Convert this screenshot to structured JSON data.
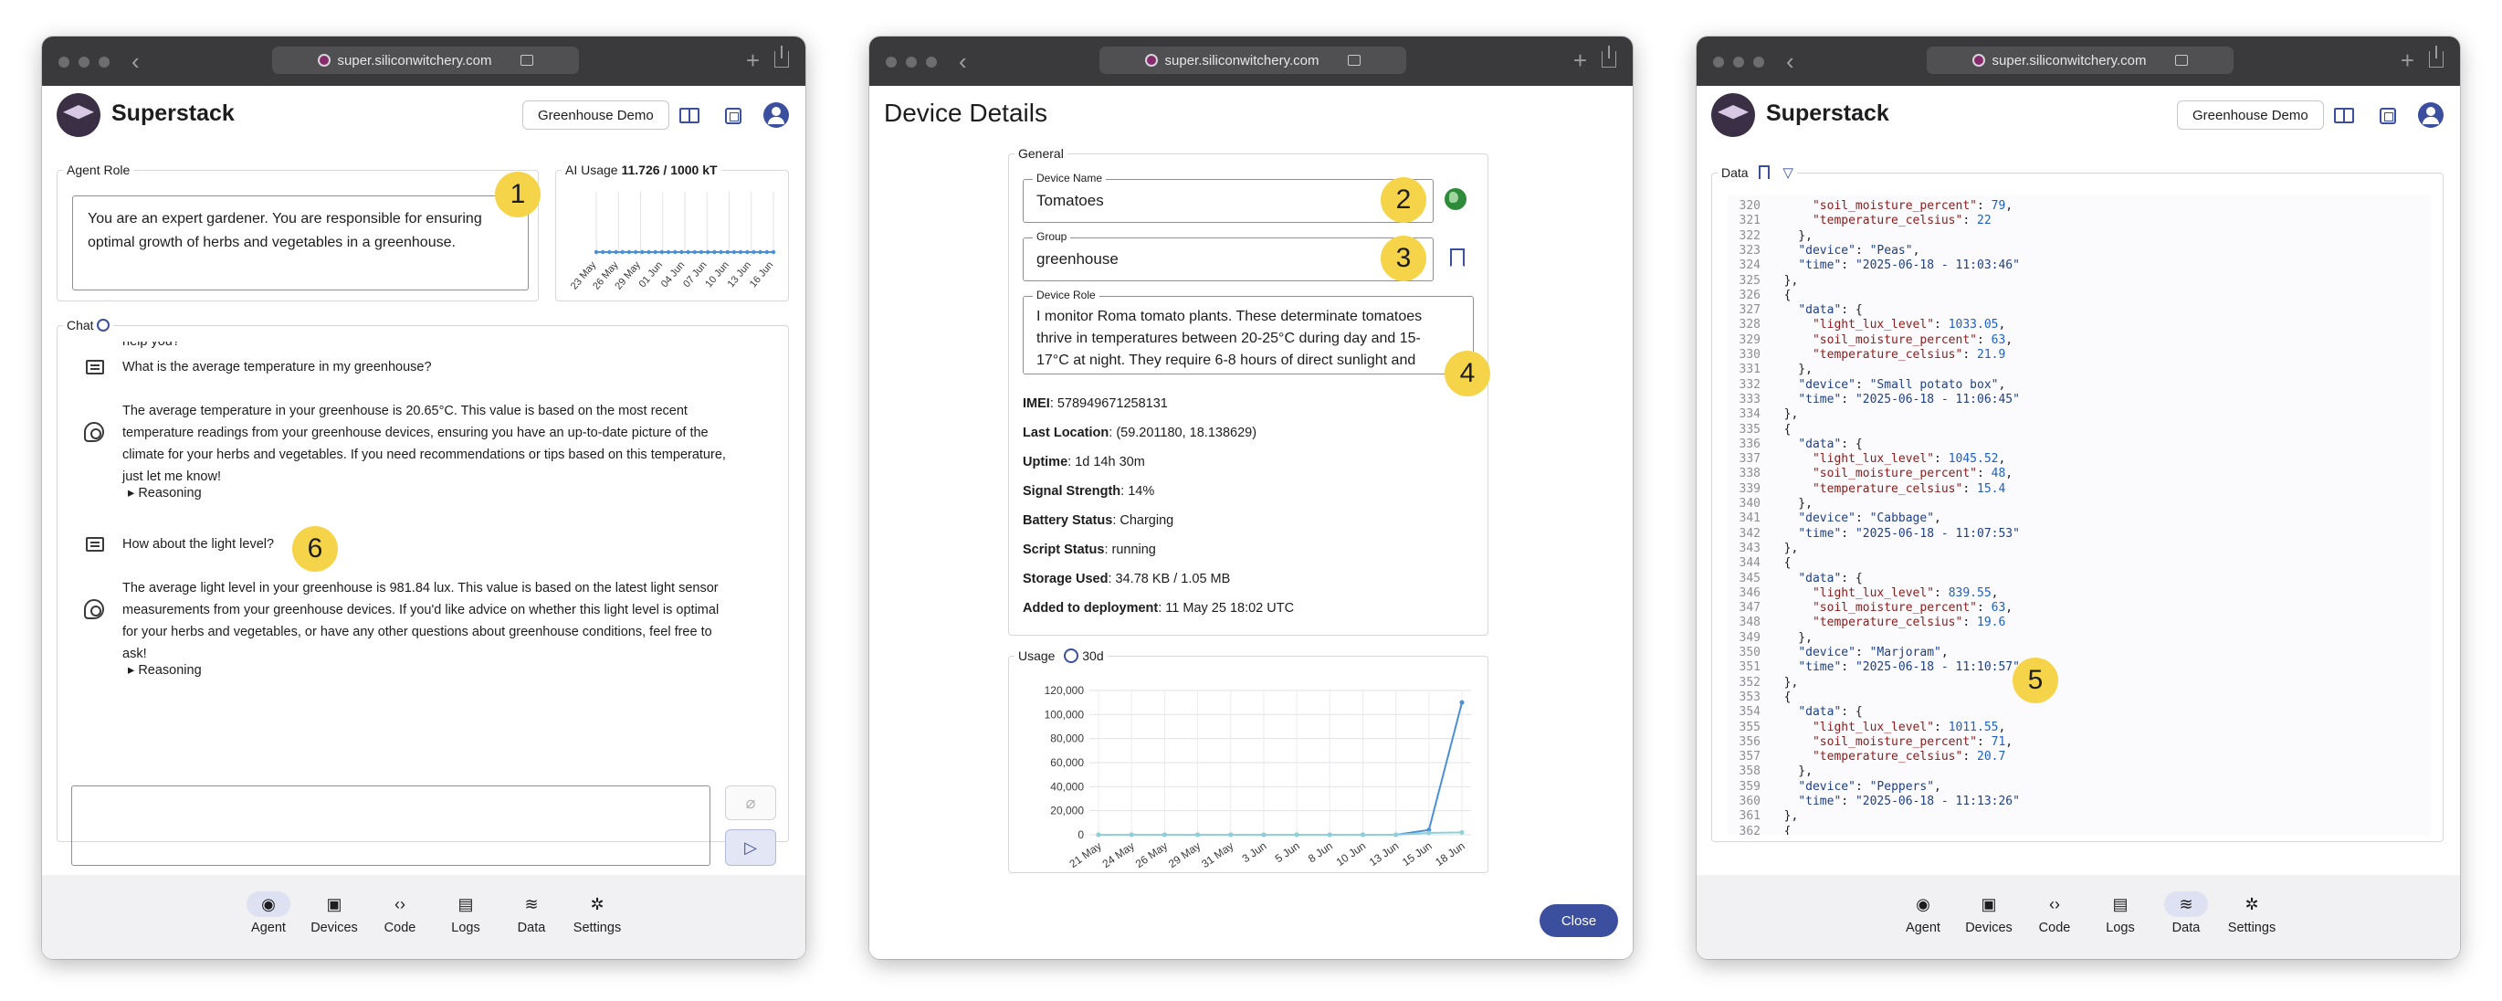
{
  "browser": {
    "url": "super.siliconwitchery.com"
  },
  "app": {
    "name": "Superstack",
    "demo_button": "Greenhouse Demo"
  },
  "nav": [
    "Agent",
    "Devices",
    "Code",
    "Logs",
    "Data",
    "Settings"
  ],
  "left": {
    "agent_role_legend": "Agent Role",
    "agent_role_text": "You are an expert gardener. You are responsible for ensuring optimal growth of herbs and vegetables in a greenhouse.",
    "usage_legend_prefix": "AI Usage ",
    "usage_value": "11.726 / 1000 kT",
    "usage_ticks": [
      "23 May",
      "26 May",
      "29 May",
      "01 Jun",
      "04 Jun",
      "07 Jun",
      "10 Jun",
      "13 Jun",
      "16 Jun"
    ],
    "chat_legend": "Chat",
    "chat": {
      "clipped_top": "help you?",
      "q1": "What is the average temperature in my greenhouse?",
      "a1": [
        "The average temperature in your greenhouse is 20.65°C. This value is based on the most recent",
        "temperature readings from your greenhouse devices, ensuring you have an up-to-date picture of the",
        "climate for your herbs and vegetables. If you need recommendations or tips based on this temperature,",
        "just let me know!"
      ],
      "reasoning1": "Reasoning",
      "q2": "How about the light level?",
      "a2": [
        "The average light level in your greenhouse is 981.84 lux. This value is based on the latest light sensor",
        "measurements from your greenhouse devices. If you'd like advice on whether this light level is optimal",
        "for your herbs and vegetables, or have any other questions about greenhouse conditions, feel free to",
        "ask!"
      ],
      "reasoning2": "Reasoning"
    },
    "badges": {
      "b1": "1",
      "b6": "6"
    },
    "active_nav": "Agent"
  },
  "middle": {
    "title": "Device Details",
    "general_legend": "General",
    "device_name_label": "Device Name",
    "device_name": "Tomatoes",
    "group_label": "Group",
    "group": "greenhouse",
    "device_role_label": "Device Role",
    "device_role_lines": [
      "I monitor Roma tomato plants. These determinate tomatoes",
      "thrive in temperatures between 20-25°C during day and 15-",
      "17°C at night. They require 6-8 hours of direct sunlight and"
    ],
    "info": [
      {
        "k": "IMEI",
        "v": ": 578949671258131"
      },
      {
        "k": "Last Location",
        "v": ": (59.201180, 18.138629)"
      },
      {
        "k": "Uptime",
        "v": ": 1d 14h 30m"
      },
      {
        "k": "Signal Strength",
        "v": ": 14%"
      },
      {
        "k": "Battery Status",
        "v": ": Charging"
      },
      {
        "k": "Script Status",
        "v": ": running"
      },
      {
        "k": "Storage Used",
        "v": ": 34.78 KB / 1.05 MB"
      },
      {
        "k": "Added to deployment",
        "v": ": 11 May 25 18:02 UTC"
      }
    ],
    "usage_legend": "Usage",
    "usage_range": "30d",
    "close_label": "Close",
    "badges": {
      "b2": "2",
      "b3": "3",
      "b4": "4"
    }
  },
  "right": {
    "data_legend": "Data",
    "badge": "5",
    "active_nav": "Data",
    "code_lines": [
      {
        "n": "320",
        "t": [
          [
            "      ",
            ""
          ],
          [
            "\"soil_moisture_percent\"",
            "s"
          ],
          [
            ": ",
            ""
          ],
          [
            "79",
            "n"
          ],
          [
            ",",
            ""
          ]
        ]
      },
      {
        "n": "321",
        "t": [
          [
            "      ",
            ""
          ],
          [
            "\"temperature_celsius\"",
            "s"
          ],
          [
            ": ",
            ""
          ],
          [
            "22",
            "n"
          ]
        ]
      },
      {
        "n": "322",
        "t": [
          [
            "    },",
            ""
          ]
        ]
      },
      {
        "n": "323",
        "t": [
          [
            "    ",
            ""
          ],
          [
            "\"device\"",
            "k"
          ],
          [
            ": ",
            ""
          ],
          [
            "\"Peas\"",
            "k"
          ],
          [
            ",",
            ""
          ]
        ]
      },
      {
        "n": "324",
        "t": [
          [
            "    ",
            ""
          ],
          [
            "\"time\"",
            "k"
          ],
          [
            ": ",
            ""
          ],
          [
            "\"2025-06-18 - 11:03:46\"",
            "k"
          ]
        ]
      },
      {
        "n": "325",
        "t": [
          [
            "  },",
            ""
          ]
        ]
      },
      {
        "n": "326",
        "t": [
          [
            "  {",
            ""
          ]
        ]
      },
      {
        "n": "327",
        "t": [
          [
            "    ",
            ""
          ],
          [
            "\"data\"",
            "k"
          ],
          [
            ": {",
            ""
          ]
        ]
      },
      {
        "n": "328",
        "t": [
          [
            "      ",
            ""
          ],
          [
            "\"light_lux_level\"",
            "s"
          ],
          [
            ": ",
            ""
          ],
          [
            "1033.05",
            "n"
          ],
          [
            ",",
            ""
          ]
        ]
      },
      {
        "n": "329",
        "t": [
          [
            "      ",
            ""
          ],
          [
            "\"soil_moisture_percent\"",
            "s"
          ],
          [
            ": ",
            ""
          ],
          [
            "63",
            "n"
          ],
          [
            ",",
            ""
          ]
        ]
      },
      {
        "n": "330",
        "t": [
          [
            "      ",
            ""
          ],
          [
            "\"temperature_celsius\"",
            "s"
          ],
          [
            ": ",
            ""
          ],
          [
            "21.9",
            "n"
          ]
        ]
      },
      {
        "n": "331",
        "t": [
          [
            "    },",
            ""
          ]
        ]
      },
      {
        "n": "332",
        "t": [
          [
            "    ",
            ""
          ],
          [
            "\"device\"",
            "k"
          ],
          [
            ": ",
            ""
          ],
          [
            "\"Small potato box\"",
            "k"
          ],
          [
            ",",
            ""
          ]
        ]
      },
      {
        "n": "333",
        "t": [
          [
            "    ",
            ""
          ],
          [
            "\"time\"",
            "k"
          ],
          [
            ": ",
            ""
          ],
          [
            "\"2025-06-18 - 11:06:45\"",
            "k"
          ]
        ]
      },
      {
        "n": "334",
        "t": [
          [
            "  },",
            ""
          ]
        ]
      },
      {
        "n": "335",
        "t": [
          [
            "  {",
            ""
          ]
        ]
      },
      {
        "n": "336",
        "t": [
          [
            "    ",
            ""
          ],
          [
            "\"data\"",
            "k"
          ],
          [
            ": {",
            ""
          ]
        ]
      },
      {
        "n": "337",
        "t": [
          [
            "      ",
            ""
          ],
          [
            "\"light_lux_level\"",
            "s"
          ],
          [
            ": ",
            ""
          ],
          [
            "1045.52",
            "n"
          ],
          [
            ",",
            ""
          ]
        ]
      },
      {
        "n": "338",
        "t": [
          [
            "      ",
            ""
          ],
          [
            "\"soil_moisture_percent\"",
            "s"
          ],
          [
            ": ",
            ""
          ],
          [
            "48",
            "n"
          ],
          [
            ",",
            ""
          ]
        ]
      },
      {
        "n": "339",
        "t": [
          [
            "      ",
            ""
          ],
          [
            "\"temperature_celsius\"",
            "s"
          ],
          [
            ": ",
            ""
          ],
          [
            "15.4",
            "n"
          ]
        ]
      },
      {
        "n": "340",
        "t": [
          [
            "    },",
            ""
          ]
        ]
      },
      {
        "n": "341",
        "t": [
          [
            "    ",
            ""
          ],
          [
            "\"device\"",
            "k"
          ],
          [
            ": ",
            ""
          ],
          [
            "\"Cabbage\"",
            "k"
          ],
          [
            ",",
            ""
          ]
        ]
      },
      {
        "n": "342",
        "t": [
          [
            "    ",
            ""
          ],
          [
            "\"time\"",
            "k"
          ],
          [
            ": ",
            ""
          ],
          [
            "\"2025-06-18 - 11:07:53\"",
            "k"
          ]
        ]
      },
      {
        "n": "343",
        "t": [
          [
            "  },",
            ""
          ]
        ]
      },
      {
        "n": "344",
        "t": [
          [
            "  {",
            ""
          ]
        ]
      },
      {
        "n": "345",
        "t": [
          [
            "    ",
            ""
          ],
          [
            "\"data\"",
            "k"
          ],
          [
            ": {",
            ""
          ]
        ]
      },
      {
        "n": "346",
        "t": [
          [
            "      ",
            ""
          ],
          [
            "\"light_lux_level\"",
            "s"
          ],
          [
            ": ",
            ""
          ],
          [
            "839.55",
            "n"
          ],
          [
            ",",
            ""
          ]
        ]
      },
      {
        "n": "347",
        "t": [
          [
            "      ",
            ""
          ],
          [
            "\"soil_moisture_percent\"",
            "s"
          ],
          [
            ": ",
            ""
          ],
          [
            "63",
            "n"
          ],
          [
            ",",
            ""
          ]
        ]
      },
      {
        "n": "348",
        "t": [
          [
            "      ",
            ""
          ],
          [
            "\"temperature_celsius\"",
            "s"
          ],
          [
            ": ",
            ""
          ],
          [
            "19.6",
            "n"
          ]
        ]
      },
      {
        "n": "349",
        "t": [
          [
            "    },",
            ""
          ]
        ]
      },
      {
        "n": "350",
        "t": [
          [
            "    ",
            ""
          ],
          [
            "\"device\"",
            "k"
          ],
          [
            ": ",
            ""
          ],
          [
            "\"Marjoram\"",
            "k"
          ],
          [
            ",",
            ""
          ]
        ]
      },
      {
        "n": "351",
        "t": [
          [
            "    ",
            ""
          ],
          [
            "\"time\"",
            "k"
          ],
          [
            ": ",
            ""
          ],
          [
            "\"2025-06-18 - 11:10:57\"",
            "k"
          ]
        ]
      },
      {
        "n": "352",
        "t": [
          [
            "  },",
            ""
          ]
        ]
      },
      {
        "n": "353",
        "t": [
          [
            "  {",
            ""
          ]
        ]
      },
      {
        "n": "354",
        "t": [
          [
            "    ",
            ""
          ],
          [
            "\"data\"",
            "k"
          ],
          [
            ": {",
            ""
          ]
        ]
      },
      {
        "n": "355",
        "t": [
          [
            "      ",
            ""
          ],
          [
            "\"light_lux_level\"",
            "s"
          ],
          [
            ": ",
            ""
          ],
          [
            "1011.55",
            "n"
          ],
          [
            ",",
            ""
          ]
        ]
      },
      {
        "n": "356",
        "t": [
          [
            "      ",
            ""
          ],
          [
            "\"soil_moisture_percent\"",
            "s"
          ],
          [
            ": ",
            ""
          ],
          [
            "71",
            "n"
          ],
          [
            ",",
            ""
          ]
        ]
      },
      {
        "n": "357",
        "t": [
          [
            "      ",
            ""
          ],
          [
            "\"temperature_celsius\"",
            "s"
          ],
          [
            ": ",
            ""
          ],
          [
            "20.7",
            "n"
          ]
        ]
      },
      {
        "n": "358",
        "t": [
          [
            "    },",
            ""
          ]
        ]
      },
      {
        "n": "359",
        "t": [
          [
            "    ",
            ""
          ],
          [
            "\"device\"",
            "k"
          ],
          [
            ": ",
            ""
          ],
          [
            "\"Peppers\"",
            "k"
          ],
          [
            ",",
            ""
          ]
        ]
      },
      {
        "n": "360",
        "t": [
          [
            "    ",
            ""
          ],
          [
            "\"time\"",
            "k"
          ],
          [
            ": ",
            ""
          ],
          [
            "\"2025-06-18 - 11:13:26\"",
            "k"
          ]
        ]
      },
      {
        "n": "361",
        "t": [
          [
            "  },",
            ""
          ]
        ]
      },
      {
        "n": "362",
        "t": [
          [
            "  {",
            ""
          ]
        ]
      }
    ]
  },
  "chart_data": [
    {
      "type": "line",
      "categories": [
        "23 May",
        "26 May",
        "29 May",
        "01 Jun",
        "04 Jun",
        "07 Jun",
        "10 Jun",
        "13 Jun",
        "16 Jun"
      ],
      "values": [
        0,
        0,
        0,
        0,
        0,
        0,
        0,
        0,
        0,
        0,
        0,
        0,
        0,
        0,
        0,
        0,
        0,
        0,
        0,
        0,
        0,
        0,
        0,
        0,
        0,
        0,
        0,
        0
      ]
    },
    {
      "type": "line",
      "categories": [
        "21 May",
        "24 May",
        "26 May",
        "29 May",
        "31 May",
        "3 Jun",
        "5 Jun",
        "8 Jun",
        "10 Jun",
        "13 Jun",
        "15 Jun",
        "18 Jun"
      ],
      "yticks": [
        "120,000",
        "100,000",
        "80,000",
        "60,000",
        "40,000",
        "20,000",
        "0"
      ],
      "ylim": [
        0,
        120000
      ],
      "series": [
        {
          "values": [
            0,
            0,
            0,
            0,
            0,
            0,
            0,
            0,
            0,
            0,
            4000,
            110000
          ]
        },
        {
          "values": [
            0,
            0,
            0,
            0,
            0,
            0,
            0,
            0,
            0,
            0,
            1500,
            2000
          ]
        }
      ]
    }
  ]
}
